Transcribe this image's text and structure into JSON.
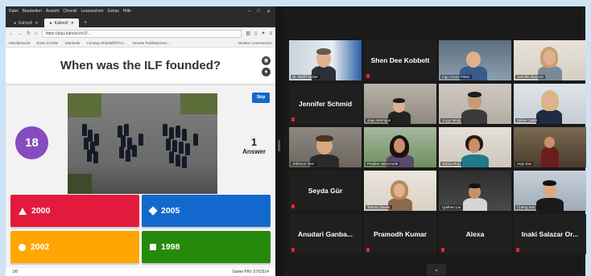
{
  "browser": {
    "menu": [
      "Datei",
      "Bearbeiten",
      "Ansicht",
      "Chronik",
      "Lesezeichen",
      "Extras",
      "Hilfe"
    ],
    "window_controls": [
      "–",
      "□",
      "✕"
    ],
    "tabs": [
      {
        "label": "Kahoot!"
      },
      {
        "label": "Kahoot!"
      }
    ],
    "url": "https://play.kahoot.it/v2/...",
    "bookmarks": [
      "Meistbesucht",
      "Erste Schritte",
      "Startseite",
      "Conway-Shindelliff-Pro...",
      "Neuste Publikationen..."
    ],
    "bookmarks_right": "Weitere Lesezeichen"
  },
  "kahoot": {
    "question": "When was the ILF founded?",
    "skip_label": "Skip",
    "timer": "18",
    "answer_count": "1",
    "answer_label": "Answer",
    "answers": [
      {
        "label": "2000",
        "color": "#e21b3c",
        "shape": "triangle"
      },
      {
        "label": "2005",
        "color": "#1368ce",
        "shape": "diamond"
      },
      {
        "label": "2002",
        "color": "#ffa602",
        "shape": "circle"
      },
      {
        "label": "1998",
        "color": "#26890c",
        "shape": "square"
      }
    ],
    "footer_left": "1/8",
    "footer_right": "Game PIN: 5762524"
  },
  "participants": [
    {
      "name": "Dr. Wolf Fischer",
      "video": true
    },
    {
      "name": "Shen Dee Kobbelt",
      "video": false
    },
    {
      "name": "Ingo Claus Pieter",
      "video": true
    },
    {
      "name": "Jennifer Bauzert",
      "video": true
    },
    {
      "name": "Jennifer Schmid",
      "video": false
    },
    {
      "name": "Joao Henrique",
      "video": true
    },
    {
      "name": "Jorge Mejia",
      "video": true
    },
    {
      "name": "Sylvie Cadet",
      "video": true
    },
    {
      "name": "Jeferson Inter",
      "video": true
    },
    {
      "name": "Paulina Valenzuela",
      "video": true
    },
    {
      "name": "Sahira Ruiz",
      "video": true
    },
    {
      "name": "Anja Ssa",
      "video": true
    },
    {
      "name": "Seyda Gür",
      "video": false
    },
    {
      "name": "Tammy Daviet",
      "video": true
    },
    {
      "name": "Quitheo Lia",
      "video": true
    },
    {
      "name": "Cheng Sun",
      "video": true
    },
    {
      "name": "Anudari Ganba...",
      "video": false
    },
    {
      "name": "Pramodh Kumar",
      "video": false
    },
    {
      "name": "Alexa",
      "video": false
    },
    {
      "name": "Inaki Salazar Or...",
      "video": false
    }
  ],
  "colors": {
    "timer": "#864cbf",
    "skip": "#1368ce",
    "active_speaker": "#c6e05b"
  }
}
